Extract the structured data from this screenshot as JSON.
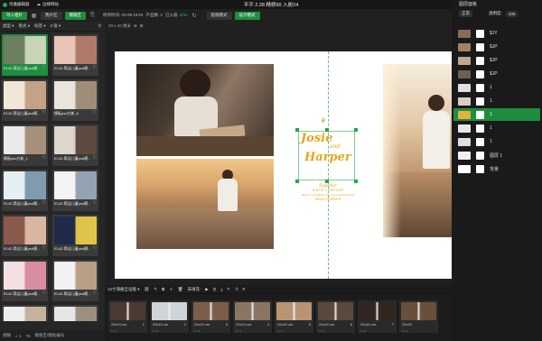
{
  "app": {
    "name": "优雅编辑器",
    "online": "边缘网站",
    "title": "平平 2.28 精修50 入册24"
  },
  "window_controls": [
    "—",
    "▢",
    "✕"
  ],
  "toolbar": {
    "import_label": "导入相片",
    "tab_public": "我片区",
    "tab_template": "模版区",
    "modified_label": "修改时间: 03-09 10:04",
    "products_label": "产品数: 1",
    "count_prefix": "已入册: ",
    "count_value": "2/11",
    "version_mode": "套版模式",
    "design_mode": "设计模式"
  },
  "left_panel": {
    "filters": [
      "类型 ▾",
      "版式 ▾",
      "标签 ▾",
      "3 张 ▾"
    ],
    "cards": [
      {
        "label": "E142-简洁儿童psd模...",
        "c1": "#6d7f5f",
        "c2": "#c8d3b8",
        "sel": true
      },
      {
        "label": "E142-简洁儿童psd模...",
        "c1": "#e8c4b8",
        "c2": "#b07a6a"
      },
      {
        "label": "E142-简洁儿童psd模...",
        "c1": "#f1e7d8",
        "c2": "#c4a286"
      },
      {
        "label": "模板psd方新_6",
        "c1": "#e9e4dc",
        "c2": "#9f8d77"
      },
      {
        "label": "模板psd方新_1",
        "c1": "#eaeaea",
        "c2": "#a6907c"
      },
      {
        "label": "E142-简洁儿童psd模...",
        "c1": "#ddd6cc",
        "c2": "#5c4a3e"
      },
      {
        "label": "E142-简洁儿童psd模...",
        "c1": "#e5eef2",
        "c2": "#7e9bb0"
      },
      {
        "label": "E142-简洁儿童psd模...",
        "c1": "#f3f3f3",
        "c2": "#94a3b1"
      },
      {
        "label": "E142-简洁儿童psd模...",
        "c1": "#8c5a4c",
        "c2": "#d9b6a0"
      },
      {
        "label": "E142-简洁儿童psd模...",
        "c1": "#1f2a4a",
        "c2": "#e0c34a"
      },
      {
        "label": "E142-简洁儿童psd模...",
        "c1": "#f4dfe2",
        "c2": "#d98da0"
      },
      {
        "label": "E142-简洁儿童psd模...",
        "c1": "#f2f2f2",
        "c2": "#b89f86"
      },
      {
        "label": "",
        "c1": "#eee",
        "c2": "#c5b29c"
      },
      {
        "label": "",
        "c1": "#e6e6e6",
        "c2": "#9d8f80"
      }
    ],
    "footer": [
      "想删",
      "◐ 1",
      "76",
      "模板区/模板编号"
    ]
  },
  "canvas": {
    "size_label": "20 x 10 厘米",
    "script_line1": "Josie",
    "script_and": "and",
    "script_line2": "Harper",
    "small1": "Together",
    "small2": "SINCE FOREVER",
    "small3": "Whish it incredible to be young and together",
    "small4": "SINCE FOREVER"
  },
  "strip": {
    "title": "12寸海报全设版 ▾",
    "unselected": "未填充:",
    "items": [
      {
        "label": "20x10 cm",
        "num": "1",
        "c": "#4b3a30"
      },
      {
        "label": "20x10 cm",
        "num": "2",
        "c": "#cfd4d8"
      },
      {
        "label": "20x10 cm",
        "num": "3",
        "c": "#7c5d49"
      },
      {
        "label": "20x10 cm",
        "num": "4",
        "c": "#8a7563"
      },
      {
        "label": "20x10 cm",
        "num": "5",
        "c": "#b99372"
      },
      {
        "label": "20x10 cm",
        "num": "6",
        "c": "#5a4a3d"
      },
      {
        "label": "20x10 cm",
        "num": "7",
        "c": "#332620"
      },
      {
        "label": "20x10",
        "num": "",
        "c": "#6a4f3c"
      }
    ]
  },
  "right_panel": {
    "header": "图层面板",
    "blend": "正常",
    "opacity_label": "透明度:",
    "opacity_value": "100",
    "layers": [
      {
        "name": "$JY",
        "thumb": "#8d6a58"
      },
      {
        "name": "$JP",
        "thumb": "#a38068"
      },
      {
        "name": "$JP",
        "thumb": "#c3a48e"
      },
      {
        "name": "$JP",
        "thumb": "#6d5f55"
      },
      {
        "name": "1",
        "thumb": "#e0e0e0"
      },
      {
        "name": "1",
        "thumb": "#d8cfc2"
      },
      {
        "name": "1",
        "thumb": "#e2b23a",
        "sel": true
      },
      {
        "name": "1",
        "thumb": "#e8e8e8"
      },
      {
        "name": "1",
        "thumb": "#dedede"
      },
      {
        "name": "图层 1",
        "thumb": "#f0f0f0"
      },
      {
        "name": "背景",
        "thumb": "#ffffff"
      }
    ]
  }
}
